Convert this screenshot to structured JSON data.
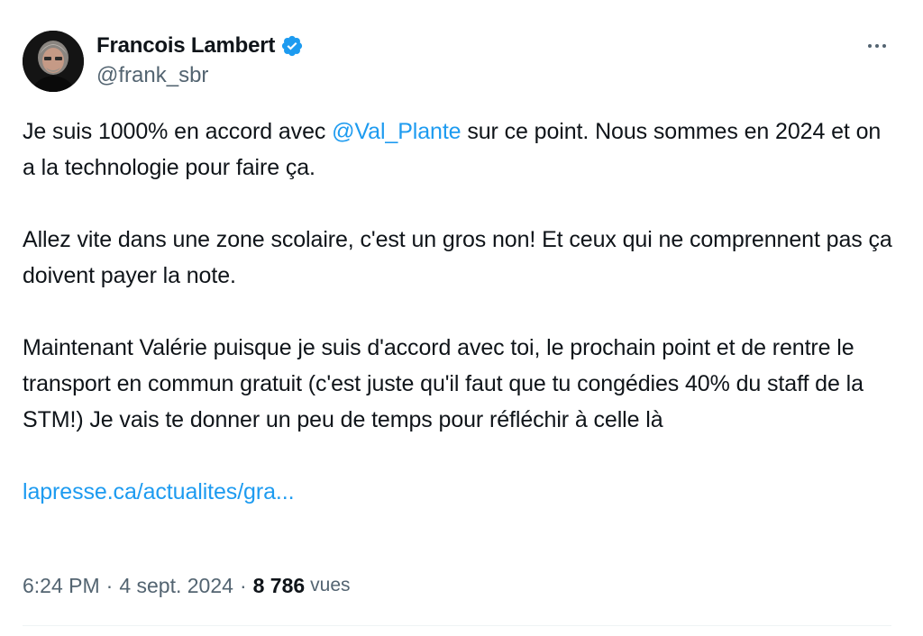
{
  "author": {
    "display_name": "Francois Lambert",
    "handle": "@frank_sbr",
    "verified": true
  },
  "tweet": {
    "line1_pre": "Je suis 1000% en accord avec ",
    "mention": "@Val_Plante",
    "line1_post": " sur ce point.  Nous sommes en 2024 et on a la technologie pour faire ça.",
    "para2": "Allez vite dans une zone scolaire, c'est un gros non! Et ceux qui ne comprennent pas ça doivent payer la note.",
    "para3": "Maintenant Valérie puisque je suis d'accord avec toi, le prochain point et de rentre le transport en commun gratuit (c'est juste qu'il faut que tu congédies 40% du staff de la STM!) Je vais te donner un peu de temps pour réfléchir à celle là",
    "link": "lapresse.ca/actualites/gra..."
  },
  "meta": {
    "time": "6:24 PM",
    "separator": "·",
    "date": "4 sept. 2024",
    "views_count": "8 786",
    "views_label": "vues"
  },
  "icons": {
    "verified": "verified-badge-icon",
    "more": "more-horizontal-icon"
  },
  "colors": {
    "text": "#0f1419",
    "secondary": "#536471",
    "link": "#1d9bf0"
  }
}
